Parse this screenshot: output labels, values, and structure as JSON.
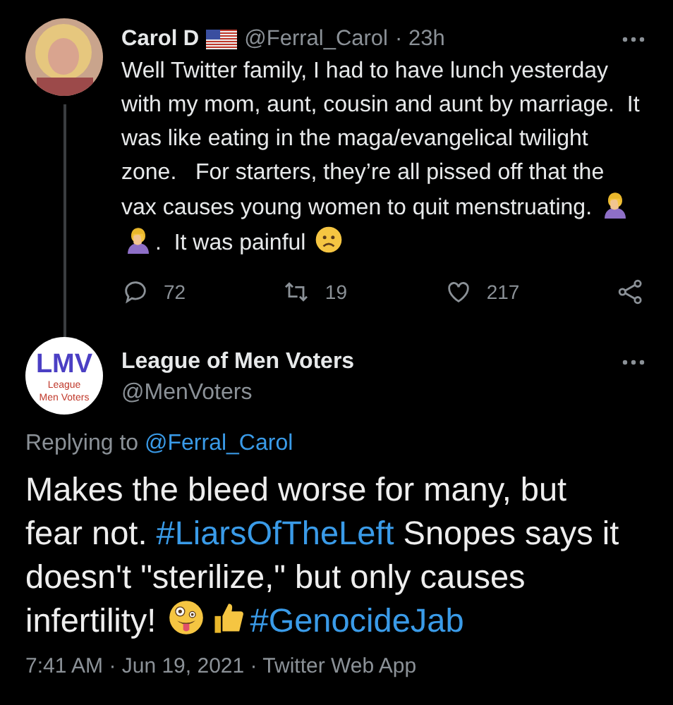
{
  "tweet": {
    "name": "Carol D",
    "handle": "@Ferral_Carol",
    "time": "· 23h",
    "body": [
      {
        "kind": "text",
        "text": "Well Twitter family, I had to have lunch yesterday with my mom, aunt, cousin and aunt by marriage.  It was like eating in the maga/evangelical twilight zone.   For starters, they’re all pissed off that the vax causes young women to quit menstruating. "
      },
      {
        "kind": "emoji"
      },
      {
        "kind": "emoji"
      },
      {
        "kind": "text",
        "text": ".  It was painful "
      },
      {
        "kind": "emoji"
      }
    ],
    "actions": [
      {
        "kind": "reply",
        "count": "72"
      },
      {
        "kind": "retweet",
        "count": "19"
      },
      {
        "kind": "like",
        "count": "217"
      },
      {
        "kind": "share"
      }
    ]
  },
  "reply": {
    "name": "League of Men Voters",
    "handle": "@MenVoters",
    "avatar": {
      "initials": "LMV",
      "line1": "League",
      "line2": "Men Voters"
    },
    "replying_label": "Replying to",
    "replying_to": "@Ferral_Carol",
    "body": [
      {
        "kind": "text",
        "text": "Makes the bleed worse for many, but fear not. "
      },
      {
        "kind": "hashtag",
        "text": "#LiarsOfTheLeft"
      },
      {
        "kind": "text",
        "text": " Snopes says it doesn't \"sterilize,\" but only causes infertility! "
      },
      {
        "kind": "emoji"
      },
      {
        "kind": "emoji"
      },
      {
        "kind": "hashtag",
        "text": "#GenocideJab"
      }
    ],
    "meta": "7:41 AM · Jun 19, 2021 · Twitter Web App"
  }
}
